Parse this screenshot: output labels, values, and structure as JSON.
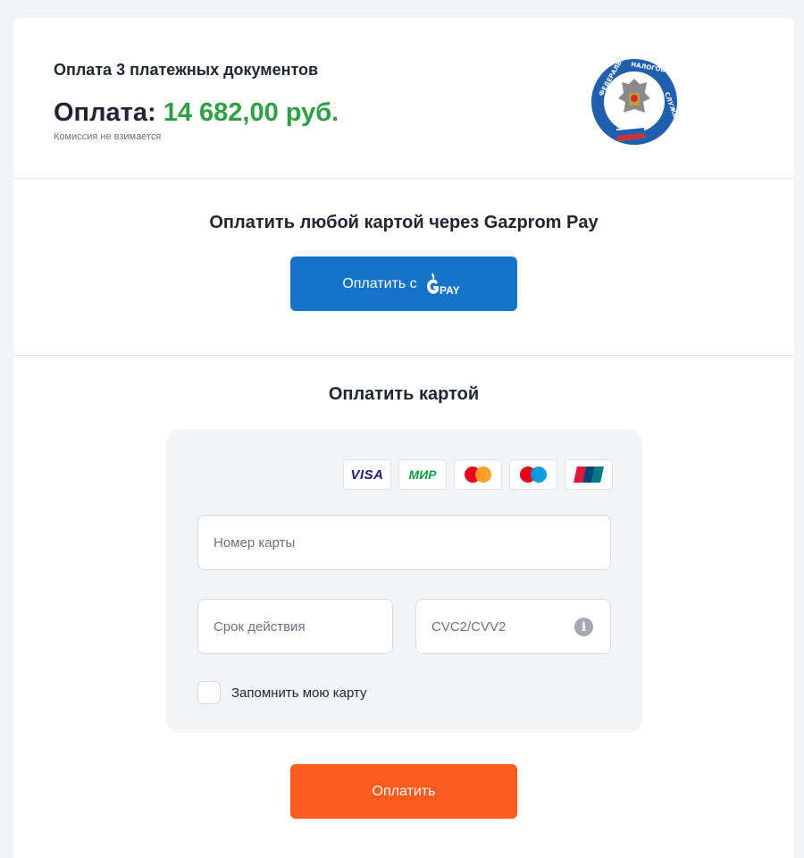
{
  "header": {
    "doc_title": "Оплата 3 платежных документов",
    "amount_label": "Оплата:",
    "amount_value": "14 682,00 руб.",
    "commission": "Комиссия не взимается",
    "logo_icon": "federal-tax-service-emblem"
  },
  "gpay": {
    "title": "Оплатить любой картой через Gazprom Pay",
    "button_label": "Оплатить с",
    "button_logo_text": "PAY",
    "button_color": "#1573c9"
  },
  "card_form": {
    "title": "Оплатить картой",
    "brands": {
      "visa": "VISA",
      "mir": "МИР",
      "mastercard": "mastercard-icon",
      "maestro": "maestro-icon",
      "unionpay": "unionpay-icon"
    },
    "card_number_placeholder": "Номер карты",
    "expiry_placeholder": "Срок действия",
    "cvc_placeholder": "CVC2/CVV2",
    "info_icon": "i",
    "remember_label": "Запомнить мою карту",
    "remember_checked": false
  },
  "pay_button": {
    "label": "Оплатить",
    "color": "#fc5b20"
  },
  "colors": {
    "amount_green": "#2ea043",
    "form_bg": "#f3f4f6"
  }
}
